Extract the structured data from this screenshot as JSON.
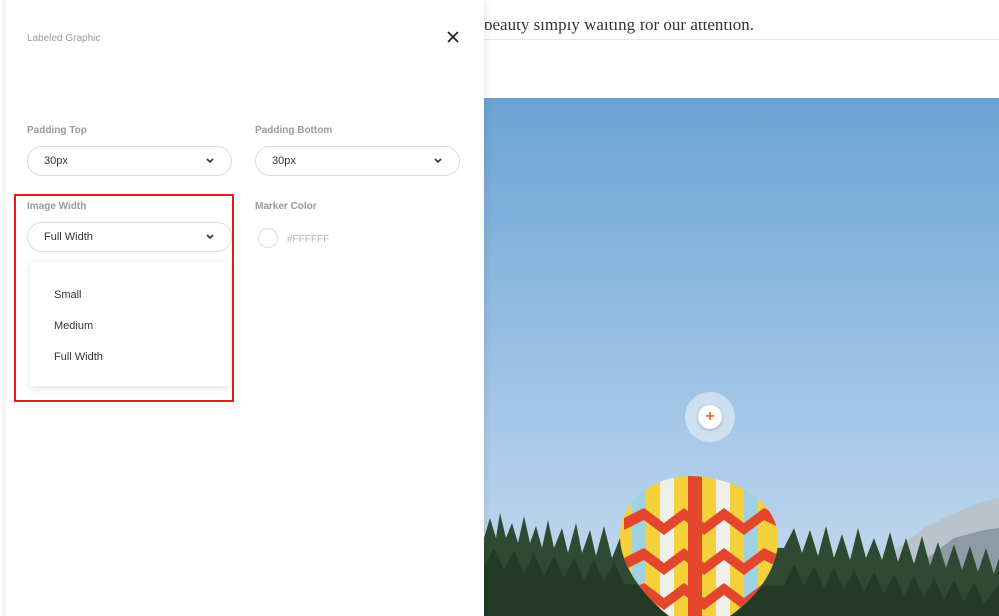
{
  "background_page": {
    "text_line": "beauty simply waiting for our attention."
  },
  "panel": {
    "title": "Labeled Graphic",
    "close_icon": "close-icon"
  },
  "fields": {
    "padding_top": {
      "label": "Padding Top",
      "value": "30px"
    },
    "padding_bottom": {
      "label": "Padding Bottom",
      "value": "30px"
    },
    "image_width": {
      "label": "Image Width",
      "value": "Full Width",
      "options": [
        "Small",
        "Medium",
        "Full Width"
      ]
    },
    "marker_color": {
      "label": "Marker Color",
      "value": "#FFFFFF"
    }
  },
  "hotspot": {
    "symbol": "+"
  },
  "colors": {
    "highlight": "#e01c1c",
    "hotspot_plus": "#f06a2c",
    "label_gray": "#9a9a9a"
  }
}
